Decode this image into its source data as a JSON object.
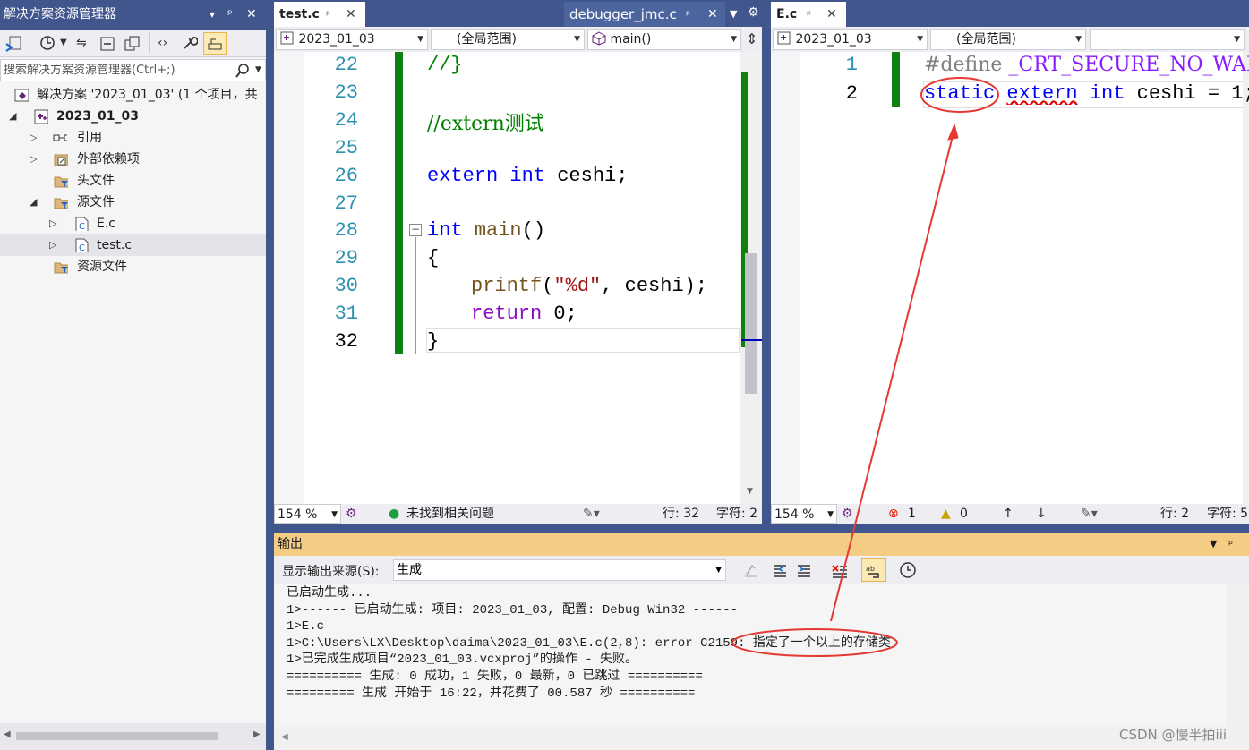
{
  "solution_explorer": {
    "title": "解决方案资源管理器",
    "title_icons": [
      "▾",
      "ᵖ",
      "✕"
    ],
    "search_placeholder": "搜索解决方案资源管理器(Ctrl+;)",
    "tree": [
      {
        "label": "解决方案 '2023_01_03' (1 个项目，共",
        "level": 0
      },
      {
        "label": "2023_01_03",
        "level": 1,
        "expanded": true,
        "bold": true
      },
      {
        "label": "引用",
        "level": 2
      },
      {
        "label": "外部依赖项",
        "level": 2
      },
      {
        "label": "头文件",
        "level": 2
      },
      {
        "label": "源文件",
        "level": 2,
        "expanded": true
      },
      {
        "label": "E.c",
        "level": 3
      },
      {
        "label": "test.c",
        "level": 3,
        "selected": true
      },
      {
        "label": "资源文件",
        "level": 2
      }
    ]
  },
  "left_editor": {
    "tabs": [
      {
        "label": "test.c",
        "active": true,
        "pin": "ᵖ",
        "close": "✕"
      },
      {
        "label": "debugger_jmc.c",
        "active": false,
        "pin": "ᵖ",
        "close": "✕"
      }
    ],
    "nav": {
      "project": "2023_01_03",
      "scope": "(全局范围)",
      "member": "main()"
    },
    "lines": [
      {
        "n": "22",
        "text": "//}"
      },
      {
        "n": "23",
        "text": ""
      },
      {
        "n": "24",
        "text": "//extern测试"
      },
      {
        "n": "25",
        "text": ""
      },
      {
        "n": "26",
        "text": "extern int ceshi;"
      },
      {
        "n": "27",
        "text": ""
      },
      {
        "n": "28",
        "text": "int main()"
      },
      {
        "n": "29",
        "text": "{"
      },
      {
        "n": "30",
        "text": "printf(\"%d\", ceshi);"
      },
      {
        "n": "31",
        "text": "return 0;"
      },
      {
        "n": "32",
        "text": "}"
      }
    ],
    "status": {
      "zoom": "154 %",
      "issues": "未找到相关问题",
      "line": "行: 32",
      "char": "字符: 2"
    }
  },
  "right_editor": {
    "tabs": [
      {
        "label": "E.c",
        "active": true,
        "pin": "ᵖ",
        "close": "✕"
      }
    ],
    "nav": {
      "project": "2023_01_03",
      "scope": "(全局范围)",
      "member": ""
    },
    "lines": [
      {
        "n": "1",
        "text": "#define _CRT_SECURE_NO_WARNIN"
      },
      {
        "n": "2",
        "text": "static extern int ceshi = 1;"
      }
    ],
    "status": {
      "zoom": "154 %",
      "errors": "1",
      "warnings": "0",
      "line": "行: 2",
      "char": "字符: 5"
    }
  },
  "output": {
    "title": "输出",
    "source_label": "显示输出来源(S):",
    "source_value": "生成",
    "lines": [
      "已启动生成...",
      "1>------ 已启动生成: 项目: 2023_01_03, 配置: Debug Win32 ------",
      "1>E.c",
      "1>C:\\Users\\LX\\Desktop\\daima\\2023_01_03\\E.c(2,8): error C2159: 指定了一个以上的存储类",
      "1>已完成生成项目“2023_01_03.vcxproj”的操作 - 失败。",
      "========== 生成: 0 成功，1 失败，0 最新，0 已跳过 ==========",
      "========= 生成 开始于 16:22，并花费了 00.587 秒 =========="
    ]
  },
  "watermark": "CSDN @慢半拍iii",
  "colors": {
    "accent": "#40568d",
    "output_header": "#f5cc84",
    "annotation": "#e53935",
    "keyword": "#0000ff",
    "comment": "#008000"
  }
}
